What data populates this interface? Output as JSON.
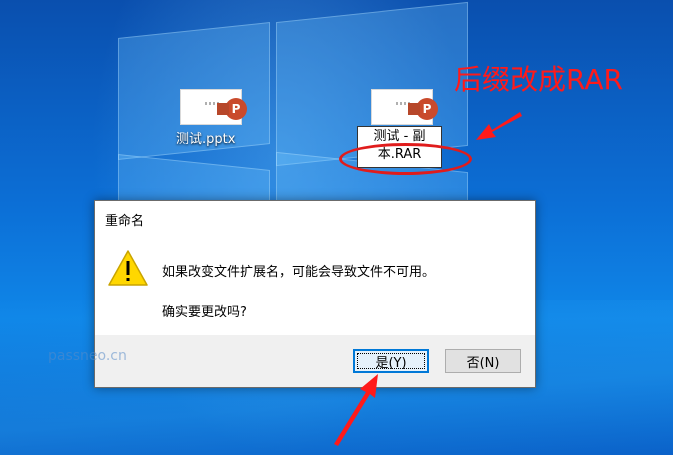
{
  "desktop": {
    "file1": {
      "label": "测试.pptx",
      "icon": "powerpoint-file-icon",
      "badge": "P"
    },
    "file2": {
      "icon": "powerpoint-file-icon",
      "badge": "P",
      "rename_line1": "测试 - 副",
      "rename_line2": "本.RAR"
    },
    "placeholder_glyph": "xxx"
  },
  "annotation": {
    "text": "后缀改成RAR",
    "color": "#ff1a1a"
  },
  "dialog": {
    "title": "重命名",
    "icon": "warning-icon",
    "message": "如果改变文件扩展名，可能会导致文件不可用。",
    "question": "确实要更改吗?",
    "yes_label": "是(Y)",
    "no_label": "否(N)",
    "accent": "#0078d7"
  },
  "watermark": "passneo.cn"
}
